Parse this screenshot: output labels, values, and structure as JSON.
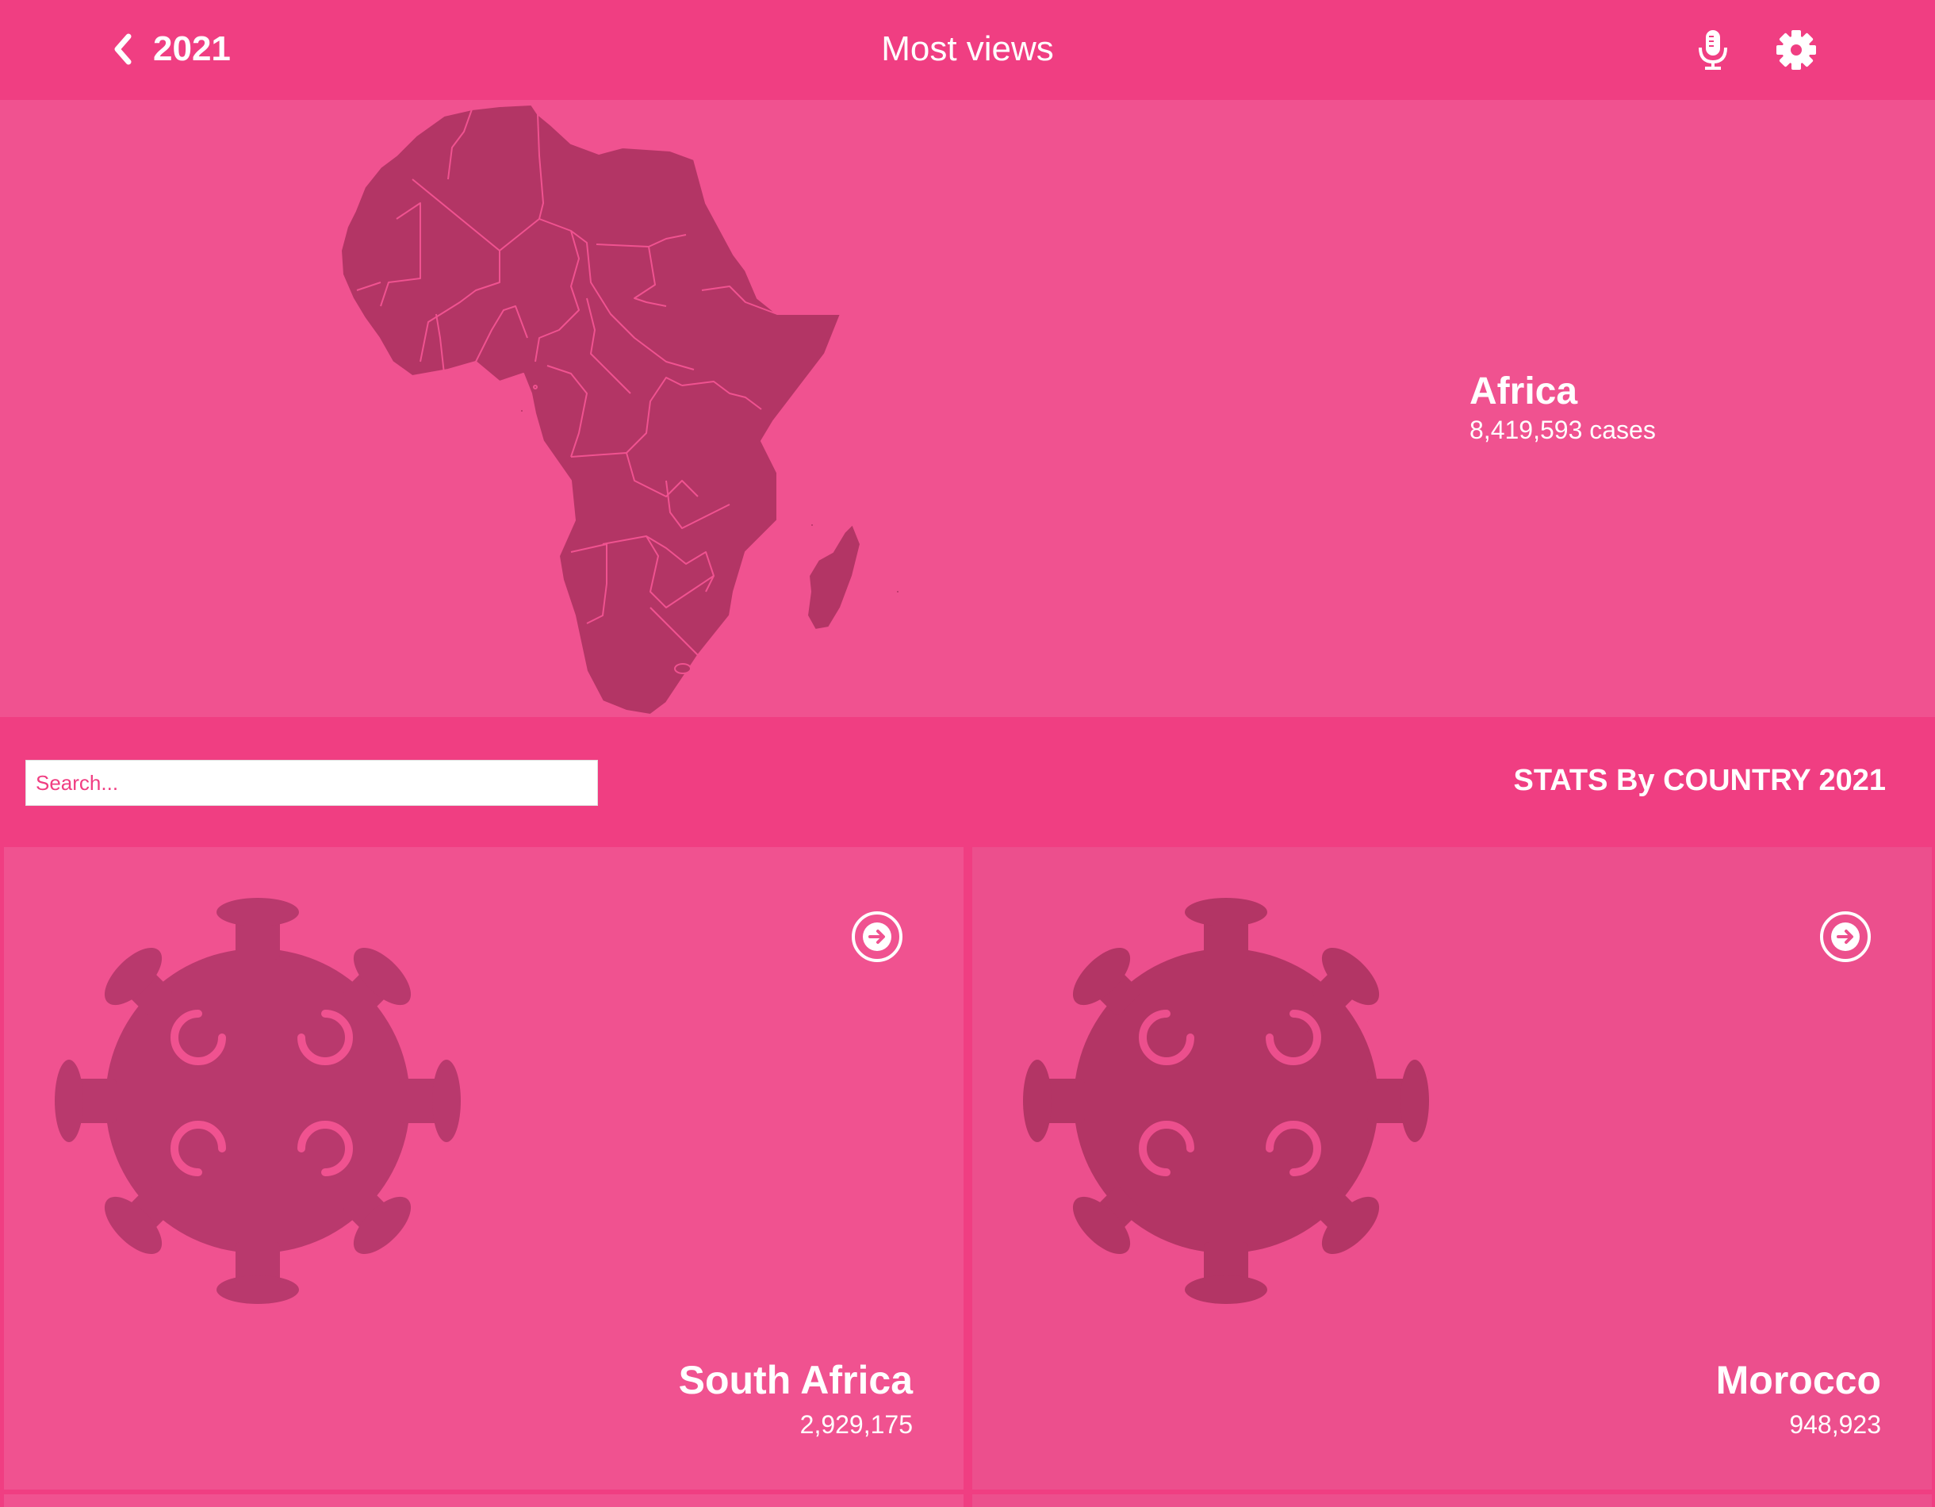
{
  "header": {
    "year": "2021",
    "title": "Most views",
    "icons": [
      "chevron-left-icon",
      "microphone-icon",
      "gear-icon"
    ]
  },
  "hero": {
    "region": "Africa",
    "cases": "8,419,593 cases"
  },
  "stats": {
    "search_placeholder": "Search...",
    "title": "STATS By COUNTRY 2021"
  },
  "cards": [
    {
      "country": "South Africa",
      "count": "2,929,175",
      "icon": "virus-icon"
    },
    {
      "country": "Morocco",
      "count": "948,923",
      "icon": "virus-icon"
    }
  ],
  "colors": {
    "header": "#f03e82",
    "hero": "#f05290",
    "map_fill": "#b33565",
    "accent_text": "#ffffff"
  }
}
